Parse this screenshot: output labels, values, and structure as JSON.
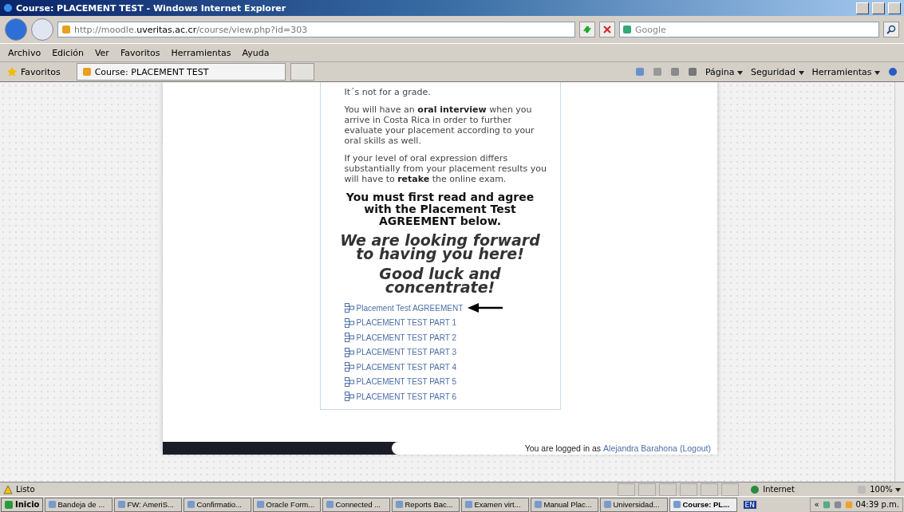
{
  "window": {
    "title": "Course: PLACEMENT TEST - Windows Internet Explorer"
  },
  "address": {
    "value_prefix": "http://moodle.",
    "value_domain": "uveritas.ac.cr",
    "value_path": "/course/view.php?id=303"
  },
  "search": {
    "placeholder": "Google"
  },
  "menu": [
    "Archivo",
    "Edición",
    "Ver",
    "Favoritos",
    "Herramientas",
    "Ayuda"
  ],
  "favorites": {
    "label": "Favoritos",
    "tabs": [
      {
        "label": "Course: PLACEMENT TEST",
        "selected": true
      }
    ]
  },
  "command_bar": [
    "Página",
    "Seguridad",
    "Herramientas"
  ],
  "content": {
    "paragraphs": [
      "It´s not for a grade.",
      "You will have an **oral interview** when you arrive in Costa Rica in order to further evaluate your placement according to your oral skills as well.",
      "If your level of oral expression differs substantially from your placement results you will have to **retake** the online exam."
    ],
    "notice": "You must first read and agree with the Placement Test AGREEMENT below.",
    "greeting": "We are looking forward to having you here!",
    "wish": "Good luck and concentrate!",
    "links": [
      {
        "label": "Placement Test AGREEMENT",
        "pointed": true
      },
      {
        "label": "PLACEMENT TEST PART 1",
        "pointed": false
      },
      {
        "label": "PLACEMENT TEST PART 2",
        "pointed": false
      },
      {
        "label": "PLACEMENT TEST PART 3",
        "pointed": false
      },
      {
        "label": "PLACEMENT TEST PART 4",
        "pointed": false
      },
      {
        "label": "PLACEMENT TEST PART 5",
        "pointed": false
      },
      {
        "label": "PLACEMENT TEST PART 6",
        "pointed": false
      }
    ]
  },
  "footer": {
    "prefix": "You are logged in as",
    "user": "Alejandra Barahona",
    "logout": "(Logout)"
  },
  "status_bar": {
    "status": "Listo",
    "zone": "Internet",
    "zoom": "100%"
  },
  "taskbar": {
    "start": "Inicio",
    "items": [
      {
        "label": "Bandeja de ...",
        "selected": false
      },
      {
        "label": "FW: AmeriS...",
        "selected": false
      },
      {
        "label": "Confirmatio...",
        "selected": false
      },
      {
        "label": "Oracle Form...",
        "selected": false
      },
      {
        "label": "Connected ...",
        "selected": false
      },
      {
        "label": "Reports Bac...",
        "selected": false
      },
      {
        "label": "Examen virt...",
        "selected": false
      },
      {
        "label": "Manual Plac...",
        "selected": false
      },
      {
        "label": "Universidad...",
        "selected": false
      },
      {
        "label": "Course: PL...",
        "selected": true
      }
    ],
    "language": "EN",
    "expand": "«",
    "clock": "04:39 p.m."
  }
}
